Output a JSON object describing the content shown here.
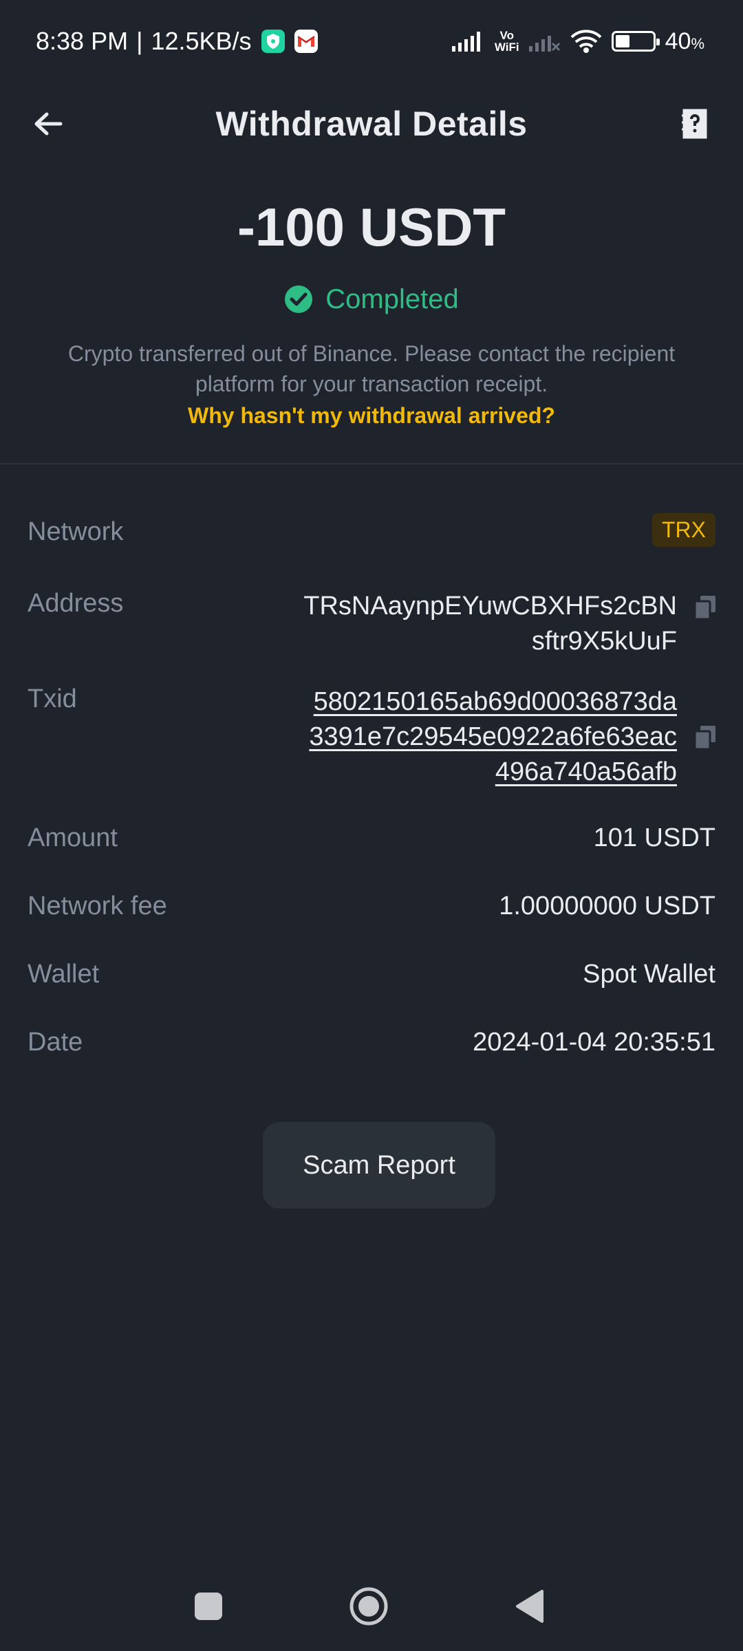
{
  "status_bar": {
    "time": "8:38 PM",
    "separator": "|",
    "network_speed": "12.5KB/s",
    "vowifi_top": "Vo",
    "vowifi_bottom": "WiFi",
    "battery_percent": "40",
    "battery_unit": "%",
    "battery_level": 0.4
  },
  "header": {
    "title": "Withdrawal Details"
  },
  "summary": {
    "amount": "-100 USDT",
    "status": "Completed",
    "status_color": "#2ebd85",
    "note": "Crypto transferred out of Binance. Please contact the recipient platform for your transaction receipt.",
    "faq_link": "Why hasn't my withdrawal arrived?"
  },
  "details": {
    "network": {
      "label": "Network",
      "value": "TRX"
    },
    "address": {
      "label": "Address",
      "line1": "TRsNAaynpEYuwCBXHFs2cBN",
      "line2": "sftr9X5kUuF"
    },
    "txid": {
      "label": "Txid",
      "line1": "5802150165ab69d00036873da",
      "line2": "3391e7c29545e0922a6fe63eac",
      "line3": "496a740a56afb"
    },
    "amount": {
      "label": "Amount",
      "value": "101 USDT"
    },
    "network_fee": {
      "label": "Network fee",
      "value": "1.00000000 USDT"
    },
    "wallet": {
      "label": "Wallet",
      "value": "Spot Wallet"
    },
    "date": {
      "label": "Date",
      "value": "2024-01-04 20:35:51"
    }
  },
  "actions": {
    "scam_report": "Scam Report"
  },
  "colors": {
    "background": "#1f232c",
    "accent": "#f0b90b",
    "success": "#2ebd85",
    "muted_text": "#848e9c"
  }
}
